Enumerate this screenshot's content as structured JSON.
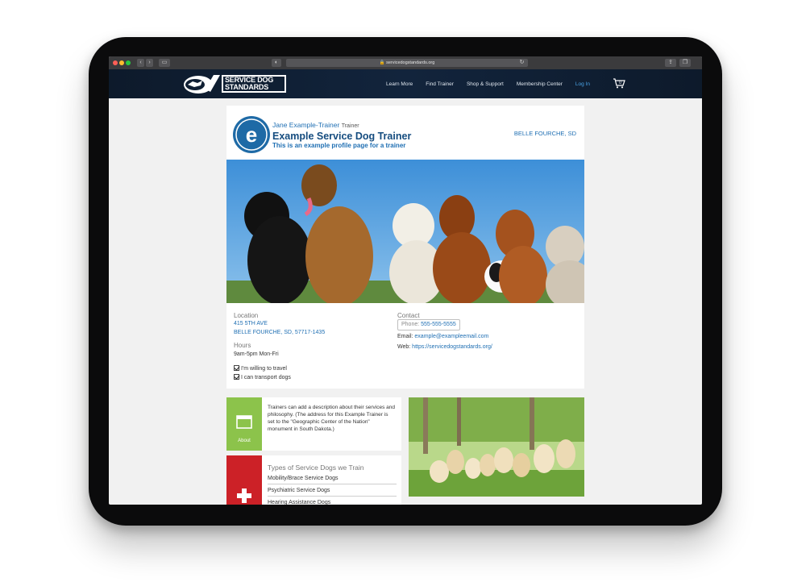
{
  "browser": {
    "url": "servicedogstandards.org"
  },
  "nav": {
    "logo_line1": "SERVICE DOG",
    "logo_line2": "STANDARDS",
    "links": [
      "Learn More",
      "Find Trainer",
      "Shop & Support",
      "Membership Center",
      "Log In"
    ],
    "cart_count": "0"
  },
  "profile": {
    "name": "Jane Example-Trainer",
    "role": "Trainer",
    "business": "Example Service Dog Trainer",
    "tagline": "This is an example profile page for a trainer",
    "city": "BELLE FOURCHE, SD",
    "avatar_letter": "e"
  },
  "location": {
    "heading": "Location",
    "line1": "415 5TH AVE",
    "line2": "BELLE FOURCHE, SD, 57717-1435"
  },
  "hours": {
    "heading": "Hours",
    "value": "9am-5pm Mon-Fri"
  },
  "options": [
    "I'm willing to travel",
    "I can transport dogs"
  ],
  "contact": {
    "heading": "Contact",
    "phone_label": "Phone:",
    "phone": "555-555-5555",
    "email_label": "Email:",
    "email": "example@exampleemail.com",
    "web_label": "Web:",
    "web": "https://servicedogstandards.org/"
  },
  "about": {
    "tile_label": "About",
    "text": "Trainers can add a description about their services and philosophy. (The address for this Example Trainer is set to the \"Geographic Center of the Nation\" monument in South Dakota.)"
  },
  "types": {
    "title": "Types of Service Dogs we Train",
    "items": [
      "Mobility/Brace Service Dogs",
      "Psychiatric Service Dogs",
      "Hearing Assistance Dogs"
    ]
  },
  "colors": {
    "nav_bg": "#0f1f33",
    "link_blue": "#1f6fb3",
    "about_green": "#8cc34b",
    "types_red": "#cc2127"
  }
}
